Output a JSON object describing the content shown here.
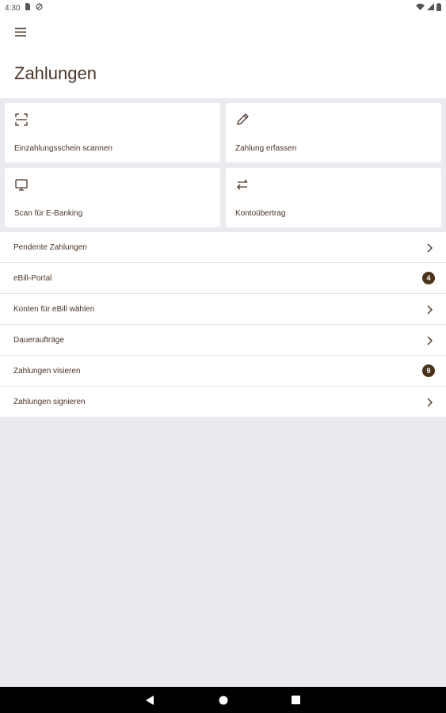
{
  "status_bar": {
    "time": "4:30",
    "left_icons": [
      "sd-card-icon",
      "no-sync-icon"
    ],
    "right_icons": [
      "wifi-icon",
      "signal-icon",
      "battery-icon"
    ]
  },
  "header": {
    "menu_icon": "hamburger-menu-icon",
    "title": "Zahlungen"
  },
  "tiles": [
    {
      "label": "Einzahlungsschein scannen",
      "icon": "scan-icon"
    },
    {
      "label": "Zahlung erfassen",
      "icon": "pencil-icon"
    },
    {
      "label": "Scan für E-Banking",
      "icon": "monitor-icon"
    },
    {
      "label": "Kontoübertrag",
      "icon": "transfer-arrows-icon"
    }
  ],
  "list": [
    {
      "label": "Pendente Zahlungen",
      "badge": null
    },
    {
      "label": "eBill-Portal",
      "badge": "4"
    },
    {
      "label": "Konten für eBill wählen",
      "badge": null
    },
    {
      "label": "Daueraufträge",
      "badge": null
    },
    {
      "label": "Zahlungen visieren",
      "badge": "9"
    },
    {
      "label": "Zahlungen signieren",
      "badge": null
    }
  ],
  "nav_bar": [
    "back-icon",
    "home-icon",
    "recents-icon"
  ],
  "colors": {
    "text": "#4a3426",
    "badge": "#4a3318",
    "background": "#e9ebee"
  }
}
